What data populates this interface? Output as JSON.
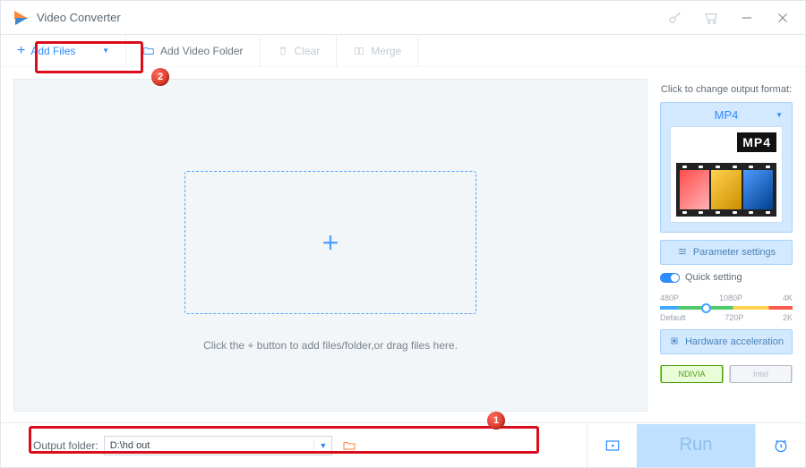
{
  "title": "Video Converter",
  "toolbar": {
    "add_label": "Add Files",
    "add_folder_label": "Add Video Folder",
    "clear_label": "Clear",
    "merge_label": "Merge"
  },
  "dropzone": {
    "hint": "Click the + button to add files/folder,or drag files here."
  },
  "side": {
    "click_to_change": "Click to change output format:",
    "format": "MP4",
    "format_tag": "MP4",
    "param_settings": "Parameter settings",
    "quick_setting": "Quick setting",
    "res_top": [
      "480P",
      "1080P",
      "4K"
    ],
    "res_bottom": [
      "Default",
      "720P",
      "2K"
    ],
    "hw_accel": "Hardware acceleration",
    "nvidia": "NDIVIA",
    "intel": "Intel"
  },
  "footer": {
    "output_label": "Output folder:",
    "output_value": "D:\\hd out",
    "run_label": "Run"
  },
  "callouts": {
    "one": "1",
    "two": "2"
  }
}
